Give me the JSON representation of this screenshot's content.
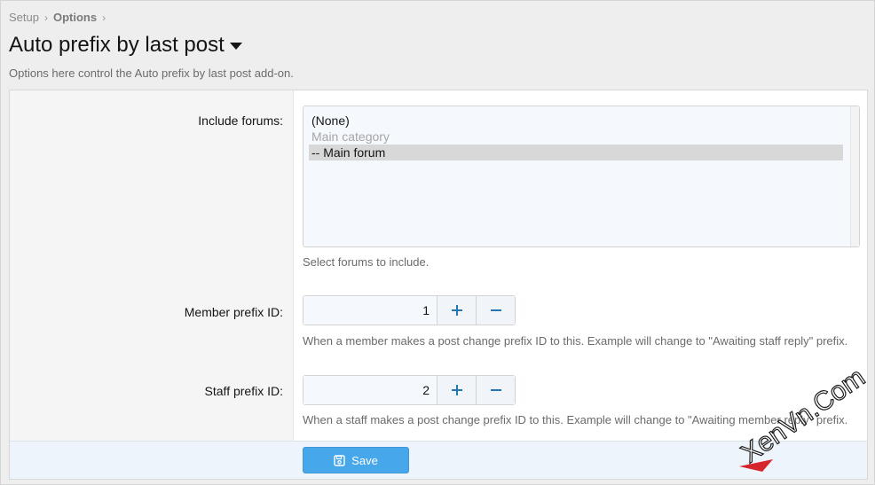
{
  "breadcrumb": {
    "items": [
      "Setup",
      "Options"
    ]
  },
  "page": {
    "title": "Auto prefix by last post",
    "description": "Options here control the Auto prefix by last post add-on."
  },
  "include_forums": {
    "label": "Include forums:",
    "options": [
      {
        "label": "(None)",
        "disabled": false,
        "selected": false
      },
      {
        "label": "Main category",
        "disabled": true,
        "selected": false
      },
      {
        "label": "-- Main forum",
        "disabled": false,
        "selected": true
      }
    ],
    "explain": "Select forums to include."
  },
  "member_prefix": {
    "label": "Member prefix ID:",
    "value": "1",
    "explain": "When a member makes a post change prefix ID to this. Example will change to \"Awaiting staff reply\" prefix."
  },
  "staff_prefix": {
    "label": "Staff prefix ID:",
    "value": "2",
    "explain": "When a staff makes a post change prefix ID to this. Example will change to \"Awaiting member reply\" prefix."
  },
  "actions": {
    "save_label": "Save"
  },
  "watermark": {
    "text": "XenVn.Com"
  },
  "colors": {
    "accent": "#47a7eb",
    "icon_blue": "#2577b1",
    "footer_bg": "#edf4fb"
  },
  "icons": {
    "increment": "plus-icon",
    "decrement": "minus-icon",
    "save": "floppy-disk-icon",
    "title_menu": "caret-down-icon",
    "breadcrumb_sep": "chevron-right-icon"
  }
}
